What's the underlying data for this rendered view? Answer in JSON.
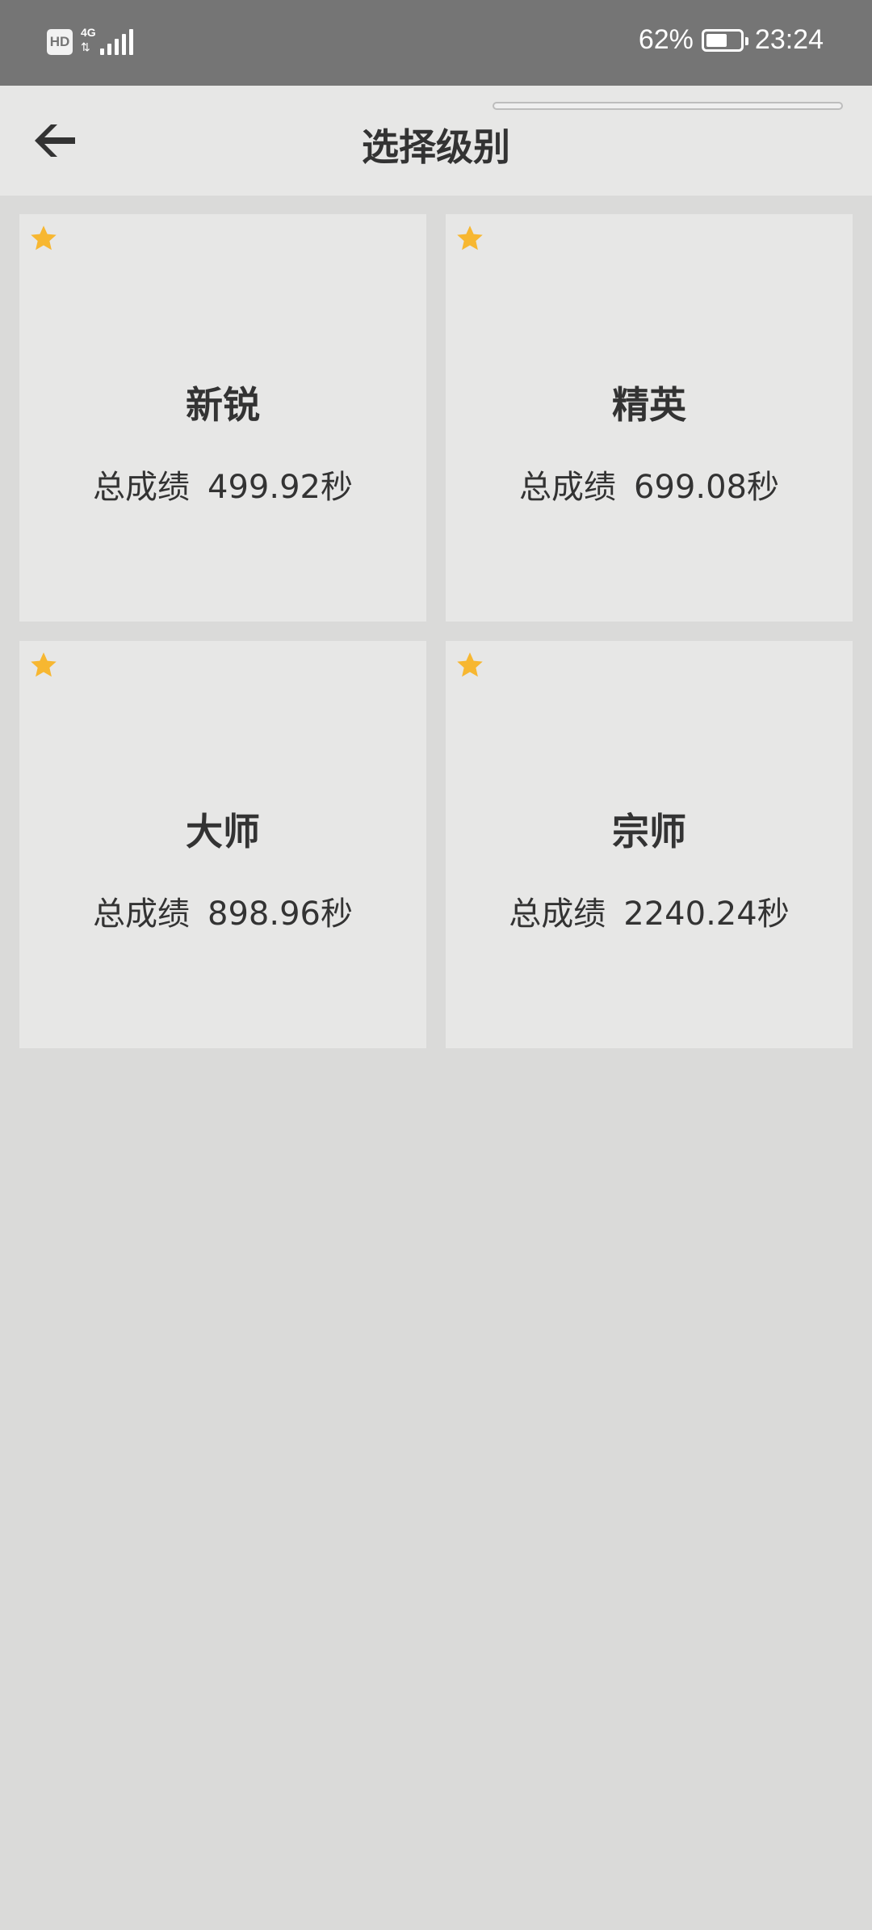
{
  "status_bar": {
    "hd": "HD",
    "network": "4G",
    "battery": "62%",
    "battery_level": 0.62,
    "time": "23:24"
  },
  "header": {
    "title": "选择级别",
    "back_icon": "arrow-left-icon"
  },
  "levels": [
    {
      "name": "新锐",
      "score_label": "总成绩",
      "score": "499.92秒",
      "star_icon": "star-icon"
    },
    {
      "name": "精英",
      "score_label": "总成绩",
      "score": "699.08秒",
      "star_icon": "star-icon"
    },
    {
      "name": "大师",
      "score_label": "总成绩",
      "score": "898.96秒",
      "star_icon": "star-icon"
    },
    {
      "name": "宗师",
      "score_label": "总成绩",
      "score": "2240.24秒",
      "star_icon": "star-icon"
    }
  ],
  "colors": {
    "status_bar": "#757575",
    "app_bar": "#e7e7e6",
    "background": "#dadad9",
    "card": "#e7e7e6",
    "star": "#f7b731",
    "text": "#333333"
  }
}
